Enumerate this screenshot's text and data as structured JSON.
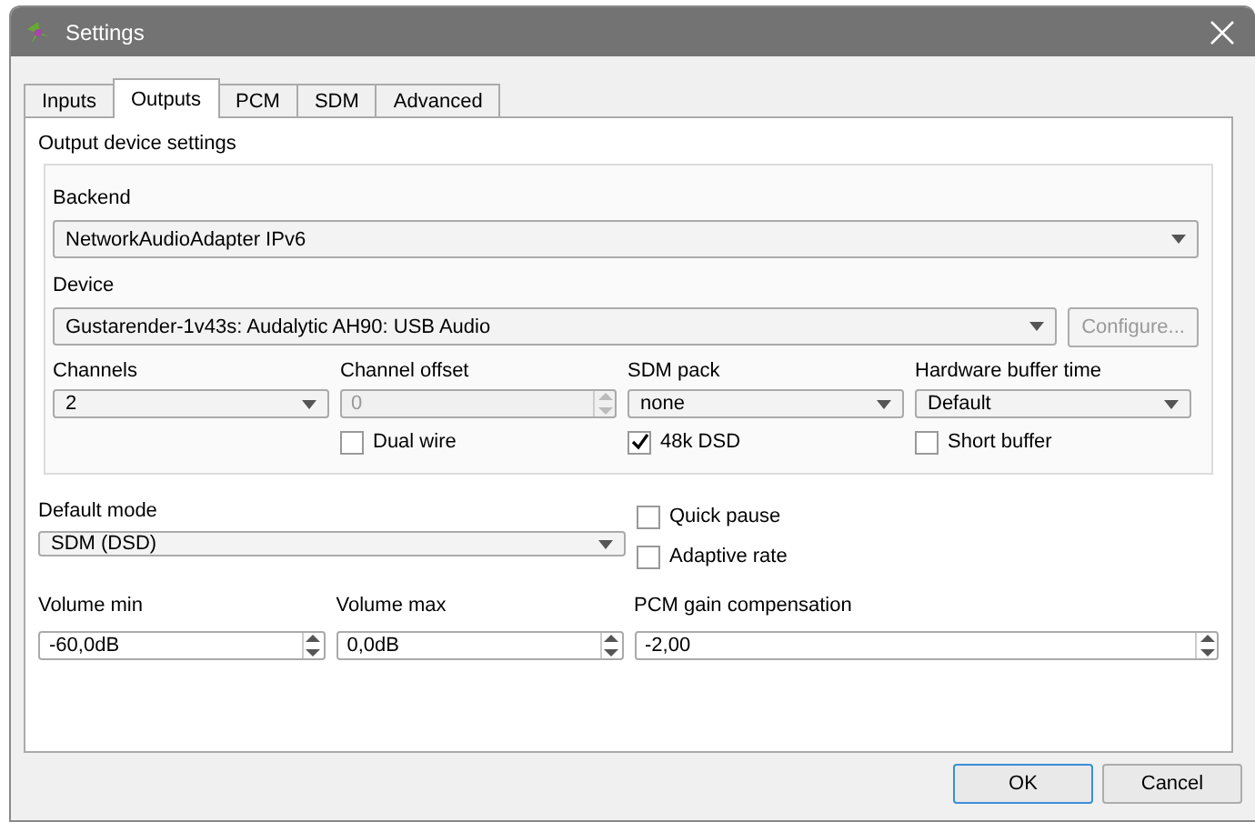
{
  "window": {
    "title": "Settings"
  },
  "tabs": [
    {
      "label": "Inputs",
      "selected": false
    },
    {
      "label": "Outputs",
      "selected": true
    },
    {
      "label": "PCM",
      "selected": false
    },
    {
      "label": "SDM",
      "selected": false
    },
    {
      "label": "Advanced",
      "selected": false
    }
  ],
  "group_title": "Output device settings",
  "backend": {
    "label": "Backend",
    "value": "NetworkAudioAdapter IPv6"
  },
  "device": {
    "label": "Device",
    "value": "Gustarender-1v43s: Audalytic AH90: USB Audio",
    "configure_button": {
      "label": "Configure...",
      "disabled": true
    }
  },
  "device_options": [
    {
      "label": "Channels",
      "kind": "combo",
      "value": "2",
      "disabled": false
    },
    {
      "label": "Channel offset",
      "kind": "spin",
      "value": "0",
      "disabled": true,
      "option": {
        "label": "Dual wire",
        "checked": false
      }
    },
    {
      "label": "SDM pack",
      "kind": "combo",
      "value": "none",
      "disabled": false,
      "option": {
        "label": "48k DSD",
        "checked": true
      }
    },
    {
      "label": "Hardware buffer time",
      "kind": "combo",
      "value": "Default",
      "disabled": false,
      "option": {
        "label": "Short buffer",
        "checked": false
      }
    }
  ],
  "default_mode": {
    "label": "Default mode",
    "value": "SDM (DSD)"
  },
  "toggles": [
    {
      "label": "Quick pause",
      "checked": false
    },
    {
      "label": "Adaptive rate",
      "checked": false
    }
  ],
  "volume_fields": [
    {
      "label": "Volume min",
      "value": "-60,0dB"
    },
    {
      "label": "Volume max",
      "value": "0,0dB"
    },
    {
      "label": "PCM gain compensation",
      "value": "-2,00"
    }
  ],
  "buttons": [
    {
      "label": "OK",
      "default": true
    },
    {
      "label": "Cancel",
      "default": false
    }
  ]
}
